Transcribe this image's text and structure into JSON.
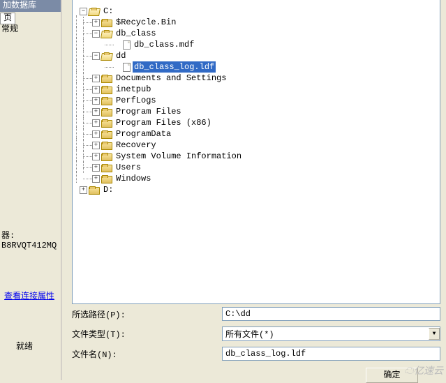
{
  "left": {
    "header": "加数据库",
    "tab1": "页",
    "tab2": "常规",
    "machine_label": "器:",
    "machine": "B8RVQT412MQ",
    "link": "查看连接属性",
    "status": "就绪"
  },
  "tree": {
    "c": {
      "label": "C:",
      "type": "folder-open",
      "toggle": "−"
    },
    "c_children": [
      {
        "label": "$Recycle.Bin",
        "type": "folder-closed",
        "toggle": "+"
      },
      {
        "label": "db_class",
        "type": "folder-open",
        "toggle": "−",
        "children": [
          {
            "label": "db_class.mdf",
            "type": "file",
            "toggle": ""
          }
        ]
      },
      {
        "label": "dd",
        "type": "folder-open",
        "toggle": "−",
        "children": [
          {
            "label": " db_class_log.ldf ",
            "type": "file",
            "toggle": "",
            "selected": true
          }
        ]
      },
      {
        "label": "Documents and Settings",
        "type": "folder-closed",
        "toggle": "+"
      },
      {
        "label": "inetpub",
        "type": "folder-closed",
        "toggle": "+"
      },
      {
        "label": "PerfLogs",
        "type": "folder-closed",
        "toggle": "+"
      },
      {
        "label": "Program Files",
        "type": "folder-closed",
        "toggle": "+"
      },
      {
        "label": "Program Files (x86)",
        "type": "folder-closed",
        "toggle": "+"
      },
      {
        "label": "ProgramData",
        "type": "folder-closed",
        "toggle": "+"
      },
      {
        "label": "Recovery",
        "type": "folder-closed",
        "toggle": "+"
      },
      {
        "label": "System Volume Information",
        "type": "folder-closed",
        "toggle": "+"
      },
      {
        "label": "Users",
        "type": "folder-closed",
        "toggle": "+"
      },
      {
        "label": "Windows",
        "type": "folder-closed",
        "toggle": "+"
      }
    ],
    "d": {
      "label": "D:",
      "type": "folder-closed",
      "toggle": "+"
    }
  },
  "form": {
    "path_label": "所选路径(P):",
    "path_value": "C:\\dd",
    "type_label": "文件类型(T):",
    "type_value": "所有文件(*)",
    "name_label": "文件名(N):",
    "name_value": "db_class_log.ldf",
    "ok": "确定"
  },
  "watermark": "亿速云"
}
